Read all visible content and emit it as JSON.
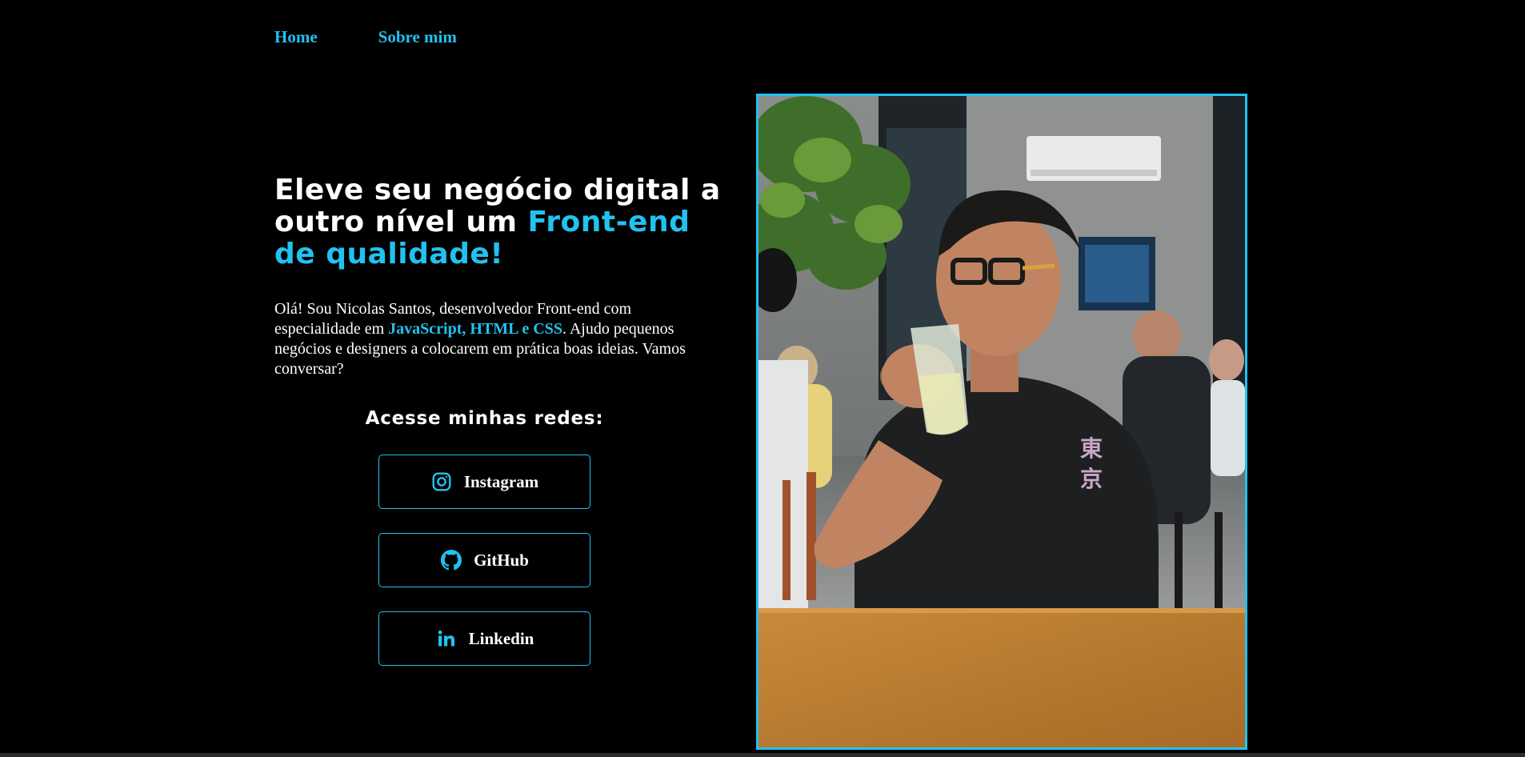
{
  "nav": {
    "home": "Home",
    "about": "Sobre mim"
  },
  "hero": {
    "headline_part1": "Eleve seu negócio digital a outro nível um ",
    "headline_accent": "Front-end de qualidade!",
    "intro_part1": "Olá! Sou Nicolas Santos, desenvolvedor Front-end com especialidade em ",
    "intro_highlight": "JavaScript, HTML e CSS",
    "intro_part2": ". Ajudo pequenos negócios e designers a colocarem em prática boas ideias. Vamos conversar?"
  },
  "networks": {
    "title": "Acesse minhas redes:",
    "buttons": [
      {
        "label": "Instagram",
        "icon": "instagram-icon"
      },
      {
        "label": "GitHub",
        "icon": "github-icon"
      },
      {
        "label": "Linkedin",
        "icon": "linkedin-icon"
      }
    ]
  },
  "colors": {
    "background": "#000000",
    "accent": "#22c2f0",
    "text": "#ffffff"
  }
}
